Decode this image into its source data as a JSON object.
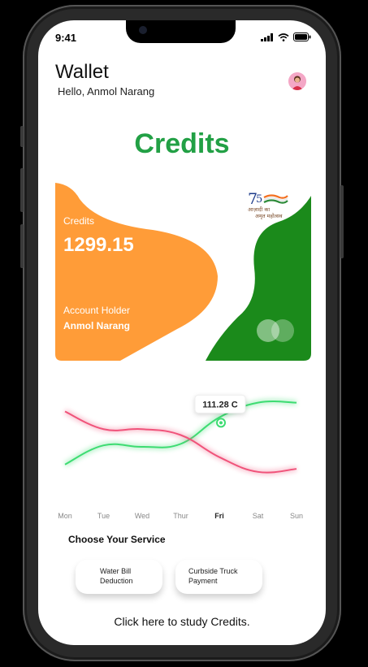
{
  "status_bar": {
    "time": "9:41"
  },
  "header": {
    "title": "Wallet",
    "greeting": "Hello, Anmol Narang"
  },
  "credits_heading": "Credits",
  "card": {
    "label": "Credits",
    "amount": "1299.15",
    "holder_label": "Account Holder",
    "holder_name": "Anmol Narang",
    "logo_text_line1": "आज़ादी का",
    "logo_text_line2": "अमृत महोत्सव",
    "colors": {
      "orange": "#ff9c38",
      "green": "#1b8a1b"
    }
  },
  "chart_data": {
    "type": "line",
    "categories": [
      "Mon",
      "Tue",
      "Wed",
      "Thur",
      "Fri",
      "Sat",
      "Sun"
    ],
    "highlight_category": "Fri",
    "tooltip": "111.28 C",
    "series": [
      {
        "color": "#3ddc72",
        "values": [
          20,
          33,
          32,
          34,
          52,
          62,
          62
        ]
      },
      {
        "color": "#f0537a",
        "values": [
          56,
          44,
          44,
          40,
          25,
          15,
          17
        ]
      }
    ],
    "ylim": [
      0,
      80
    ],
    "grid": true,
    "legend": "none"
  },
  "services": {
    "heading": "Choose Your Service",
    "buttons": [
      {
        "line1": "Water Bill",
        "line2": "Deduction"
      },
      {
        "line1": "Curbside Truck",
        "line2": "Payment"
      }
    ]
  },
  "study_link": "Click here to study Credits."
}
